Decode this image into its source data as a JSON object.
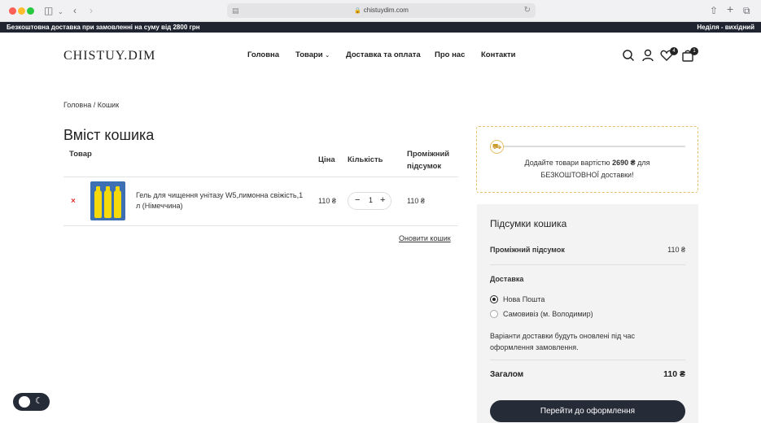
{
  "browser": {
    "url": "chistuydim.com"
  },
  "topbar": {
    "promo": "Безкоштовна доставка при замовленні на суму від 2800 грн",
    "schedule": "Неділя - вихідний"
  },
  "header": {
    "logo": "CHISTUY.DIM",
    "nav": [
      {
        "label": "Головна"
      },
      {
        "label": "Товари"
      },
      {
        "label": "Доставка та оплата"
      },
      {
        "label": "Про нас"
      },
      {
        "label": "Контакти"
      }
    ],
    "wishlist_count": "4",
    "cart_count": "1"
  },
  "breadcrumb": "Головна / Кошик",
  "cart": {
    "title": "Вміст кошика",
    "columns": {
      "product": "Товар",
      "price": "Ціна",
      "quantity": "Кількість",
      "subtotal_line1": "Проміжний",
      "subtotal_line2": "підсумок"
    },
    "items": [
      {
        "remove": "×",
        "name": "Гель для чищення унітазу W5,лимонна свіжість,1 л (Німеччина)",
        "price": "110 ₴",
        "quantity": "1",
        "subtotal": "110 ₴"
      }
    ],
    "update_label": "Оновити кошик"
  },
  "shipping_notice": {
    "line1_prefix": "Додайте товари вартістю",
    "amount": "2690 ₴",
    "line1_suffix": "для",
    "line2": "БЕЗКОШТОВНОЇ доставки!"
  },
  "totals": {
    "title": "Підсумки кошика",
    "subtotal_label": "Проміжний підсумок",
    "subtotal_value": "110 ₴",
    "delivery_label": "Доставка",
    "options": [
      {
        "label": "Нова Пошта",
        "selected": true
      },
      {
        "label": "Самовивіз (м. Володимир)",
        "selected": false
      }
    ],
    "note": "Варіанти доставки будуть оновлені під час оформлення замовлення.",
    "total_label": "Загалом",
    "total_value": "110 ₴",
    "checkout_label": "Перейти до оформлення"
  },
  "colors": {
    "dark": "#262b38",
    "accent_border": "#e5c26a",
    "remove": "#dd3333"
  }
}
